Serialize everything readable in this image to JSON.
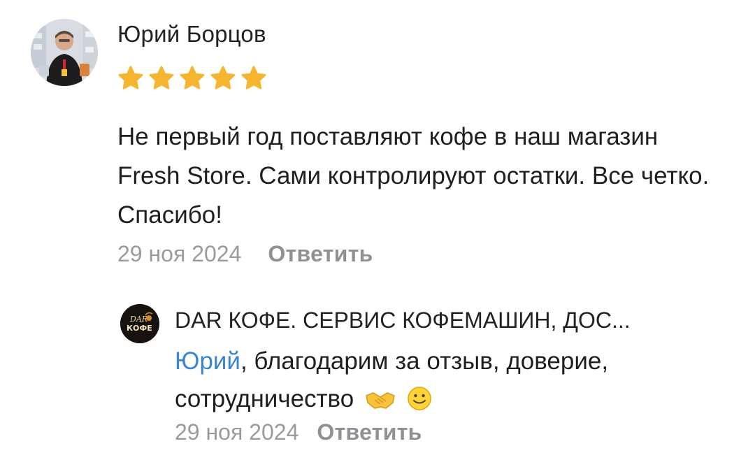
{
  "review": {
    "author_name": "Юрий Борцов",
    "rating": 5,
    "rating_max": 5,
    "text": "Не первый год поставляют кофе в наш магазин Fresh Store. Сами контролируют остатки. Все четко. Спасибо!",
    "date": "29 ноя 2024",
    "reply_label": "Ответить"
  },
  "reply": {
    "logo_text_top": "DAR",
    "logo_text_bottom": "КОФЕ",
    "author_name": "DAR КОФЕ. СЕРВИС КОФЕМАШИН, ДОС...",
    "mention": "Юрий",
    "text": ", благодарим за отзыв, доверие, сотрудничество",
    "emojis": [
      "handshake-emoji",
      "smile-emoji"
    ],
    "date": "29 ноя 2024",
    "reply_label": "Ответить"
  },
  "colors": {
    "star": "#f5b52e",
    "mention": "#3a84d6",
    "muted": "#9a9b9d"
  }
}
